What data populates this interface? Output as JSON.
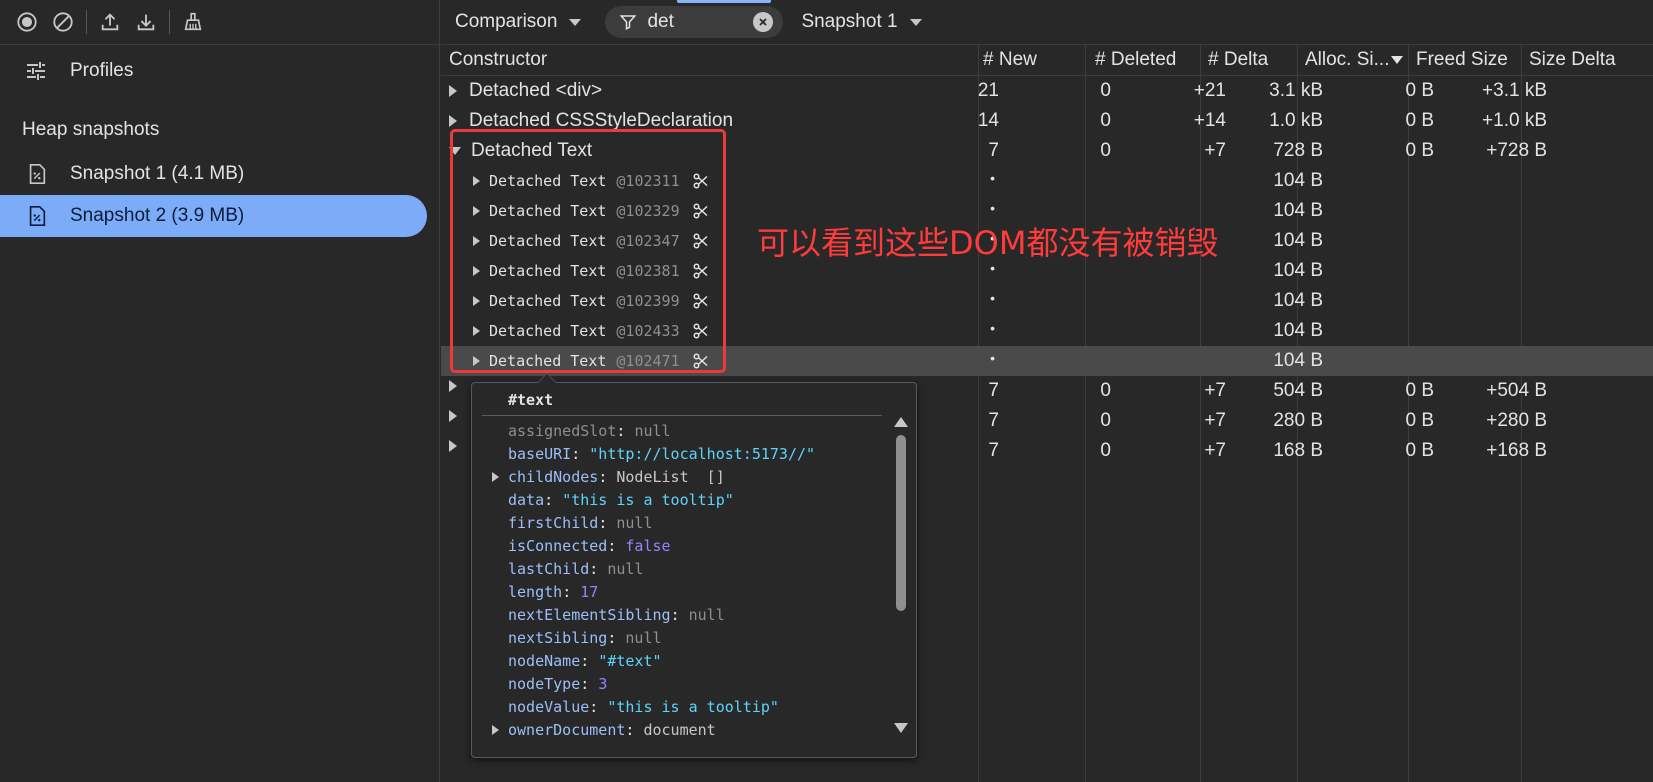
{
  "left": {
    "profiles_label": "Profiles",
    "section_title": "Heap snapshots",
    "snapshots": [
      {
        "label": "Snapshot 1 (4.1 MB)"
      },
      {
        "label": "Snapshot 2 (3.9 MB)",
        "active": true
      }
    ],
    "tools": [
      "record-icon",
      "clear-icon",
      "upload-icon",
      "download-icon",
      "garbage-collect-icon"
    ]
  },
  "toolbar": {
    "view": "Comparison",
    "filter_value": "det",
    "base_snapshot": "Snapshot 1"
  },
  "table": {
    "headers": {
      "constructor": "Constructor",
      "new": "# New",
      "deleted": "# Deleted",
      "delta": "# Delta",
      "alloc": "Alloc. Si...",
      "freed": "Freed Size",
      "size_delta": "Size Delta"
    },
    "rows": [
      {
        "name": "Detached <div>",
        "new": "21",
        "deleted": "0",
        "delta": "+21",
        "alloc": "3.1 kB",
        "freed": "0 B",
        "size_delta": "+3.1 kB"
      },
      {
        "name": "Detached CSSStyleDeclaration",
        "new": "14",
        "deleted": "0",
        "delta": "+14",
        "alloc": "1.0 kB",
        "freed": "0 B",
        "size_delta": "+1.0 kB"
      },
      {
        "name": "Detached Text",
        "new": "7",
        "deleted": "0",
        "delta": "+7",
        "alloc": "728 B",
        "freed": "0 B",
        "size_delta": "+728 B"
      }
    ],
    "children": [
      {
        "name": "Detached Text",
        "id": "@102311",
        "new": "•",
        "alloc": "104 B"
      },
      {
        "name": "Detached Text",
        "id": "@102329",
        "new": "•",
        "alloc": "104 B"
      },
      {
        "name": "Detached Text",
        "id": "@102347",
        "new": "•",
        "alloc": "104 B"
      },
      {
        "name": "Detached Text",
        "id": "@102381",
        "new": "•",
        "alloc": "104 B"
      },
      {
        "name": "Detached Text",
        "id": "@102399",
        "new": "•",
        "alloc": "104 B"
      },
      {
        "name": "Detached Text",
        "id": "@102433",
        "new": "•",
        "alloc": "104 B"
      },
      {
        "name": "Detached Text",
        "id": "@102471",
        "new": "•",
        "alloc": "104 B"
      }
    ],
    "lower_rows": [
      {
        "new": "7",
        "deleted": "0",
        "delta": "+7",
        "alloc": "504 B",
        "freed": "0 B",
        "size_delta": "+504 B"
      },
      {
        "new": "7",
        "deleted": "0",
        "delta": "+7",
        "alloc": "280 B",
        "freed": "0 B",
        "size_delta": "+280 B"
      },
      {
        "new": "7",
        "deleted": "0",
        "delta": "+7",
        "alloc": "168 B",
        "freed": "0 B",
        "size_delta": "+168 B"
      }
    ]
  },
  "annotation": {
    "text": "可以看到这些DOM都没有被销毁",
    "color": "#ff3b3b"
  },
  "popover": {
    "title": "#text",
    "props": [
      {
        "key": "assignedSlot",
        "val": "null",
        "type": "null"
      },
      {
        "key": "baseURI",
        "val": "\"http://localhost:5173//\"",
        "type": "str"
      },
      {
        "key": "childNodes",
        "val": "NodeList  []",
        "type": "obj",
        "expand": true
      },
      {
        "key": "data",
        "val": "\"this is a tooltip\"",
        "type": "str"
      },
      {
        "key": "firstChild",
        "val": "null",
        "type": "null"
      },
      {
        "key": "isConnected",
        "val": "false",
        "type": "bool"
      },
      {
        "key": "lastChild",
        "val": "null",
        "type": "null"
      },
      {
        "key": "length",
        "val": "17",
        "type": "num"
      },
      {
        "key": "nextElementSibling",
        "val": "null",
        "type": "null"
      },
      {
        "key": "nextSibling",
        "val": "null",
        "type": "null"
      },
      {
        "key": "nodeName",
        "val": "\"#text\"",
        "type": "str"
      },
      {
        "key": "nodeType",
        "val": "3",
        "type": "num"
      },
      {
        "key": "nodeValue",
        "val": "\"this is a tooltip\"",
        "type": "str"
      },
      {
        "key": "ownerDocument",
        "val": "document",
        "type": "obj",
        "expand": true
      }
    ]
  }
}
